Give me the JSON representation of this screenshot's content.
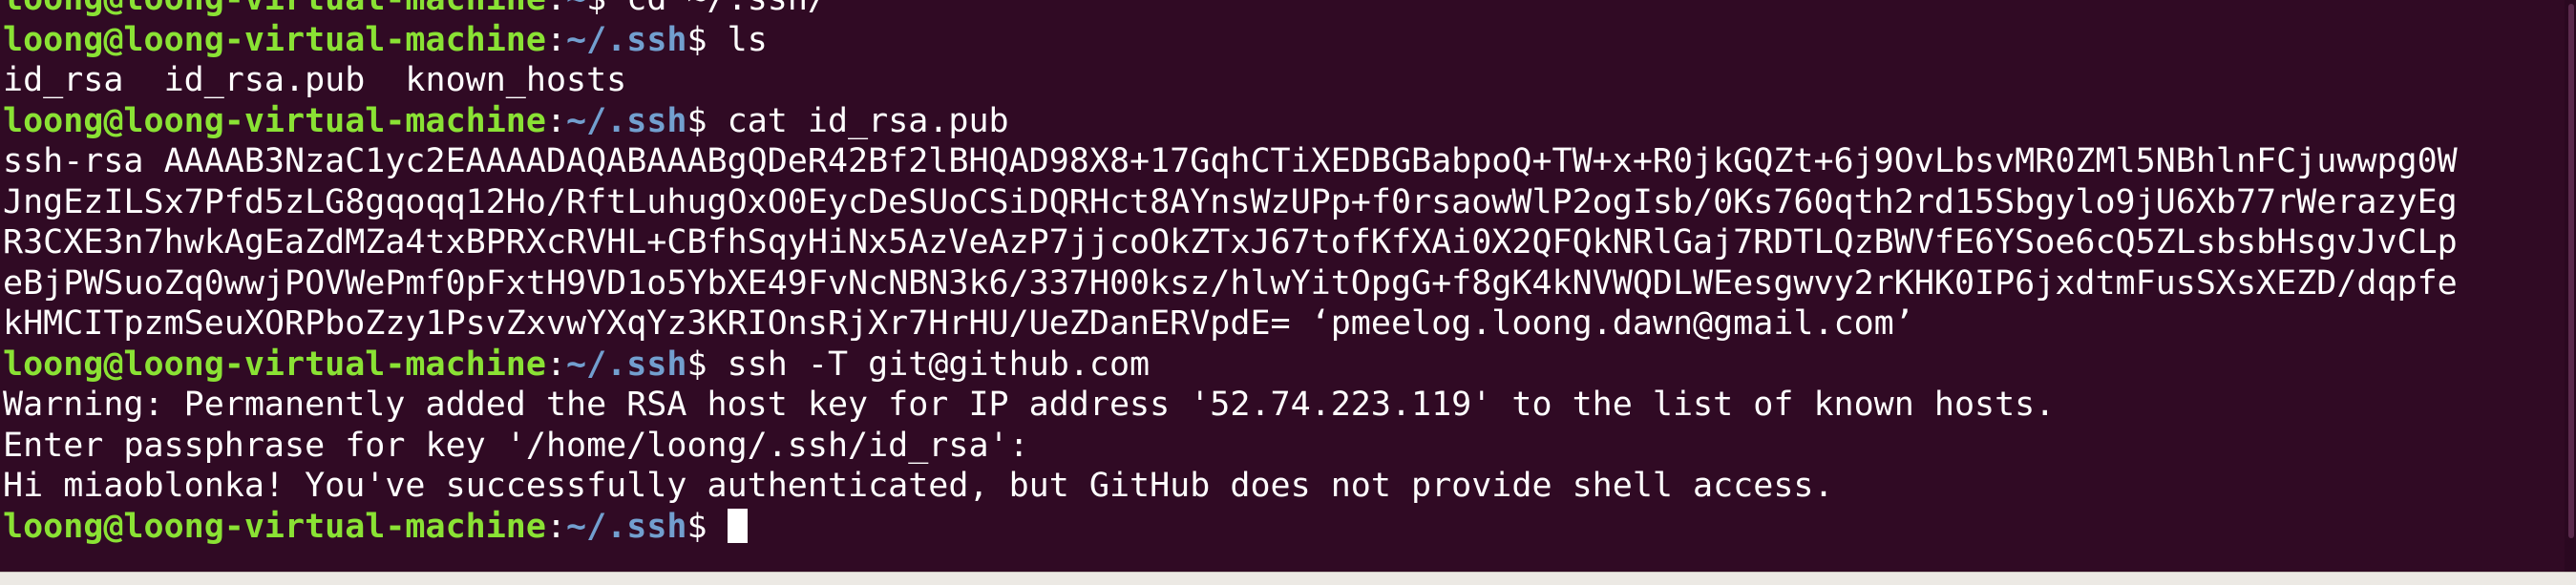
{
  "prompt": {
    "user_host": "loong@loong-virtual-machine",
    "sep": ":",
    "dollar": "$"
  },
  "lines": [
    {
      "type": "prompt",
      "path": "~",
      "cmd": " cd ~/.ssh/"
    },
    {
      "type": "prompt",
      "path": "~/.ssh",
      "cmd": " ls"
    },
    {
      "type": "output",
      "text": "id_rsa  id_rsa.pub  known_hosts"
    },
    {
      "type": "prompt",
      "path": "~/.ssh",
      "cmd": " cat id_rsa.pub"
    },
    {
      "type": "output",
      "text": "ssh-rsa AAAAB3NzaC1yc2EAAAADAQABAAABgQDeR42Bf2lBHQAD98X8+17GqhCTiXEDBGBabpoQ+TW+x+R0jkGQZt+6j9OvLbsvMR0ZMl5NBhlnFCjuwwpg0W"
    },
    {
      "type": "output",
      "text": "JngEzILSx7Pfd5zLG8gqoqq12Ho/RftLuhugOxO0EycDeSUoCSiDQRHct8AYnsWzUPp+f0rsaowWlP2ogIsb/0Ks760qth2rd15Sbgylo9jU6Xb77rWerazyEg"
    },
    {
      "type": "output",
      "text": "R3CXE3n7hwkAgEaZdMZa4txBPRXcRVHL+CBfhSqyHiNx5AzVeAzP7jjcoOkZTxJ67tofKfXAi0X2QFQkNRlGaj7RDTLQzBWVfE6YSoe6cQ5ZLsbsbHsgvJvCLp"
    },
    {
      "type": "output",
      "text": "eBjPWSuoZq0wwjPOVWePmf0pFxtH9VD1o5YbXE49FvNcNBN3k6/337H00ksz/hlwYitOpgG+f8gK4kNVWQDLWEesgwvy2rKHK0IP6jxdtmFusSXsXEZD/dqpfe"
    },
    {
      "type": "output",
      "text": "kHMCITpzmSeuXORPboZzy1PsvZxvwYXqYz3KRIOnsRjXr7HrHU/UeZDanERVpdE= ‘pmeelog.loong.dawn@gmail.com’"
    },
    {
      "type": "prompt",
      "path": "~/.ssh",
      "cmd": " ssh -T git@github.com"
    },
    {
      "type": "output",
      "text": "Warning: Permanently added the RSA host key for IP address '52.74.223.119' to the list of known hosts."
    },
    {
      "type": "output",
      "text": "Enter passphrase for key '/home/loong/.ssh/id_rsa':"
    },
    {
      "type": "output",
      "text": "Hi miaoblonka! You've successfully authenticated, but GitHub does not provide shell access."
    },
    {
      "type": "prompt",
      "path": "~/.ssh",
      "cmd": "",
      "cursor": true
    }
  ],
  "colors": {
    "background": "#300a24",
    "user_host": "#8ae234",
    "path": "#729fcf",
    "text": "#ffffff"
  }
}
